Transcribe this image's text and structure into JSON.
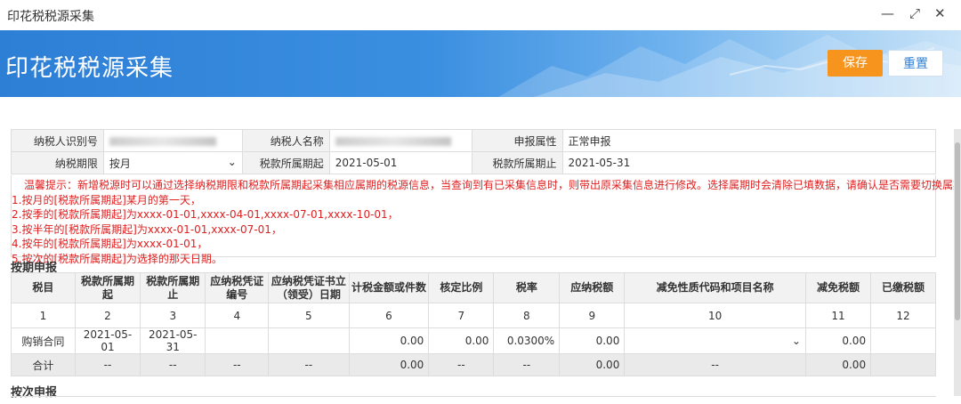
{
  "window": {
    "title": "印花税税源采集",
    "controls": [
      "—",
      "⤢",
      "✕"
    ]
  },
  "banner": {
    "title": "印花税税源采集",
    "save_label": "保存",
    "reset_label": "重置"
  },
  "info": {
    "taxpayer_id_label": "纳税人识别号",
    "taxpayer_name_label": "纳税人名称",
    "declare_attr_label": "申报属性",
    "declare_attr_value": "正常申报",
    "period_label": "纳税期限",
    "period_value": "按月",
    "start_label": "税款所属期起",
    "start_value": "2021-05-01",
    "end_label": "税款所属期止",
    "end_value": "2021-05-31"
  },
  "tips": [
    "温馨提示：新增税源时可以通过选择纳税期限和税款所属期起采集相应属期的税源信息，当查询到有已采集信息时，则带出原采集信息进行修改。选择属期时会清除已填数据，请确认是否需要切换属期。",
    "1.按月的[税款所属期起]某月的第一天，",
    "2.按季的[税款所属期起]为xxxx-01-01,xxxx-04-01,xxxx-07-01,xxxx-10-01，",
    "3.按半年的[税款所属期起]为xxxx-01-01,xxxx-07-01，",
    "4.按年的[税款所属期起]为xxxx-01-01，",
    "5.按次的[税款所属期起]为选择的那天日期。"
  ],
  "section1": "按期申报",
  "section2": "按次申报",
  "grid": {
    "headers": [
      "税目",
      "税款所属期起",
      "税款所属期止",
      "应纳税凭证编号",
      "应纳税凭证书立（领受）日期",
      "计税金额或件数",
      "核定比例",
      "税率",
      "应纳税额",
      "减免性质代码和项目名称",
      "减免税额",
      "已缴税额"
    ],
    "numbers": [
      "1",
      "2",
      "3",
      "4",
      "5",
      "6",
      "7",
      "8",
      "9",
      "10",
      "11",
      "12"
    ],
    "row": [
      "购销合同",
      "2021-05-01",
      "2021-05-31",
      "",
      "",
      "0.00",
      "0.00",
      "0.0300%",
      "0.00",
      "",
      "0.00",
      ""
    ],
    "sum": [
      "合计",
      "--",
      "--",
      "--",
      "--",
      "0.00",
      "--",
      "--",
      "0.00",
      "--",
      "0.00",
      ""
    ]
  }
}
